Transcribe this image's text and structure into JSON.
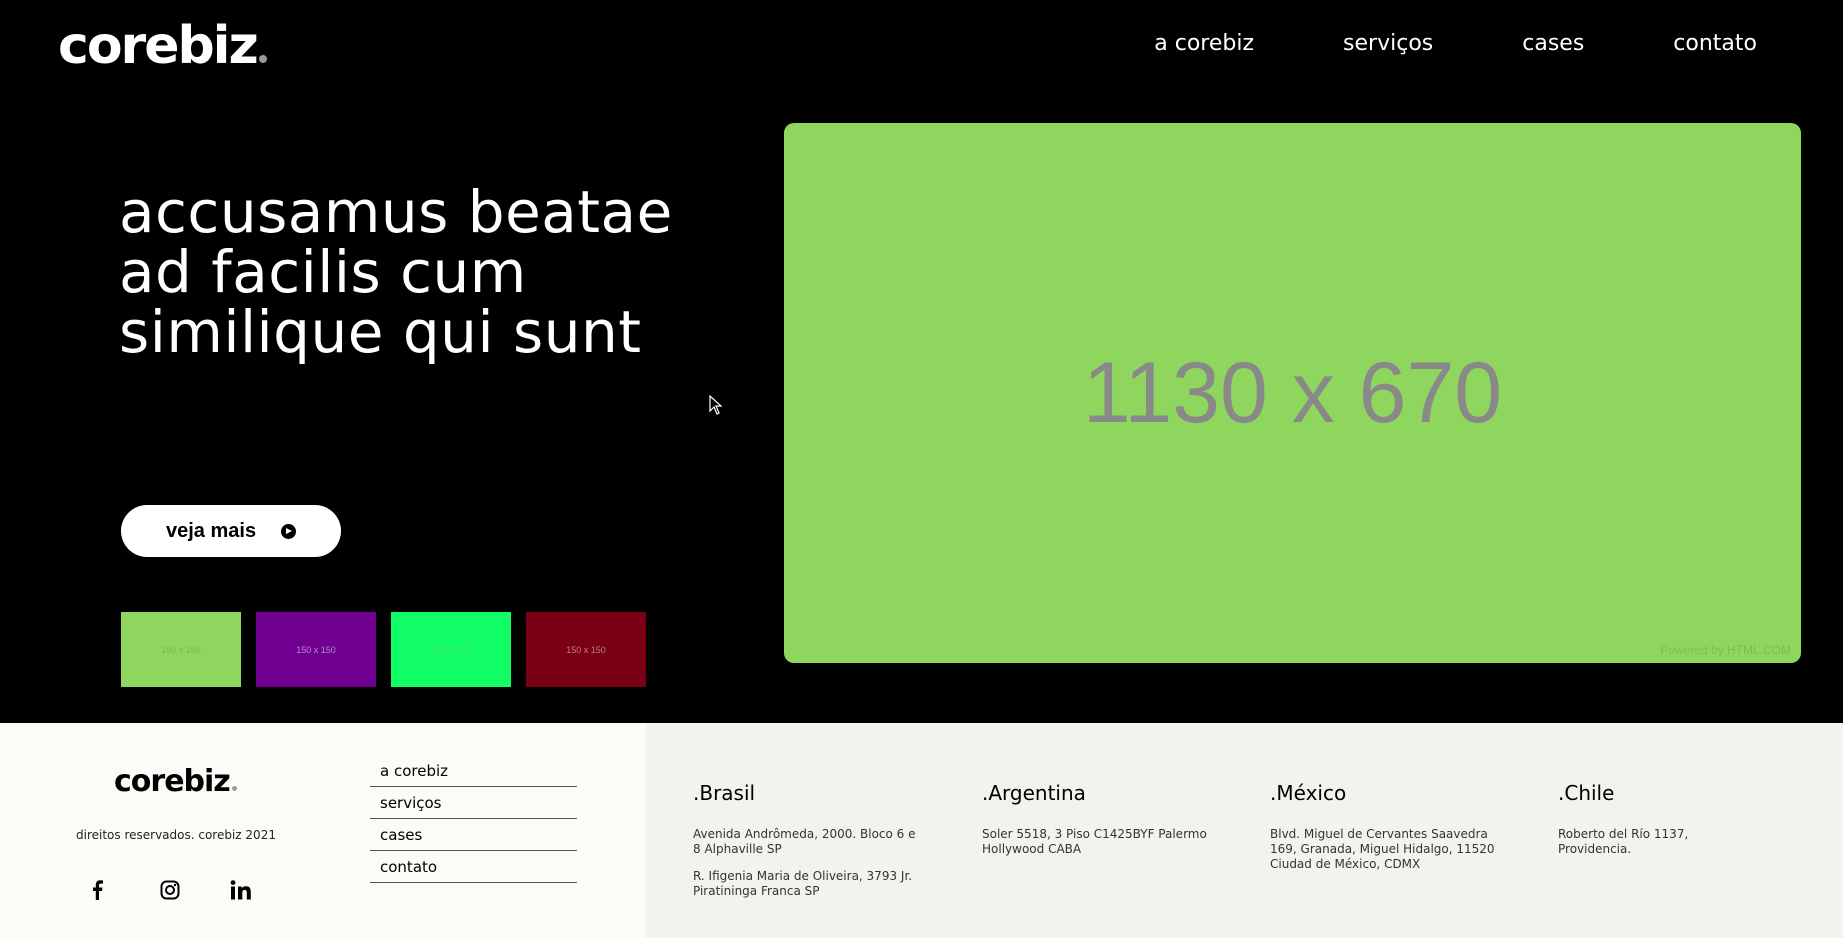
{
  "header": {
    "logo": "corebiz",
    "nav": [
      {
        "label": "a corebiz"
      },
      {
        "label": "serviços"
      },
      {
        "label": "cases"
      },
      {
        "label": "contato"
      }
    ]
  },
  "hero": {
    "title": "accusamus beatae ad facilis cum similique qui sunt",
    "cta_label": "veja mais",
    "image": {
      "label": "1130 x 670",
      "credit": "Powered by HTML.COM",
      "color": "#8fd65f"
    },
    "thumbnails": [
      {
        "label": "150 x 150",
        "color": "#8fd65f",
        "text_color": "#7db954"
      },
      {
        "label": "150 x 150",
        "color": "#6f0090",
        "text_color": "#b98ad0"
      },
      {
        "label": "150 x 150",
        "color": "#12fe67",
        "text_color": "#4fdf7f"
      },
      {
        "label": "150 x 150",
        "color": "#7a0016",
        "text_color": "#c27e88"
      }
    ]
  },
  "footer": {
    "logo": "corebiz",
    "rights": "direitos reservados. corebiz 2021",
    "socials": [
      {
        "icon": "facebook-icon",
        "glyph": "f"
      },
      {
        "icon": "instagram-icon",
        "glyph": "◎"
      },
      {
        "icon": "linkedin-icon",
        "glyph": "in"
      }
    ],
    "nav": [
      {
        "label": "a corebiz"
      },
      {
        "label": "serviços"
      },
      {
        "label": "cases"
      },
      {
        "label": "contato"
      }
    ],
    "offices": [
      {
        "name": ".Brasil",
        "addresses": [
          "Avenida Andrômeda, 2000. Bloco 6 e 8 Alphaville SP",
          "R. Ifigenia Maria de Oliveira, 3793 Jr. Piratininga Franca SP"
        ]
      },
      {
        "name": ".Argentina",
        "addresses": [
          "Soler 5518, 3 Piso C1425BYF Palermo Hollywood CABA"
        ]
      },
      {
        "name": ".México",
        "addresses": [
          "Blvd. Miguel de Cervantes Saavedra 169, Granada, Miguel Hidalgo, 11520 Ciudad de México, CDMX"
        ]
      },
      {
        "name": ".Chile",
        "addresses": [
          "Roberto del Río 1137, Providencia."
        ]
      }
    ]
  }
}
